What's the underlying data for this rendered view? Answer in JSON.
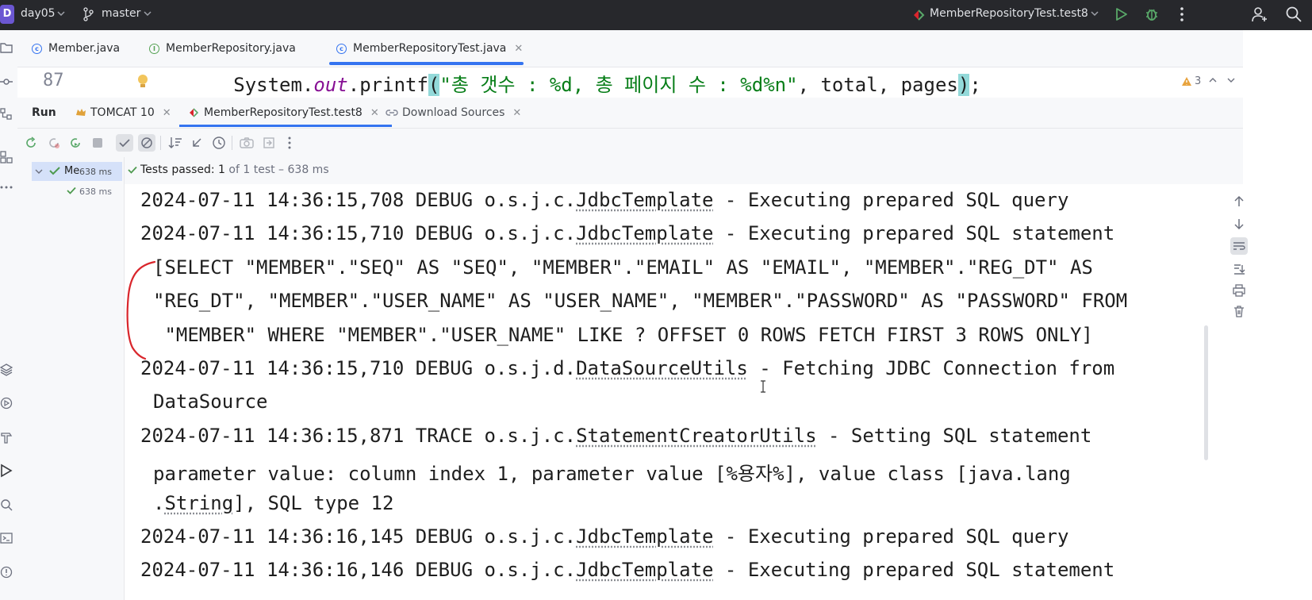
{
  "titlebar": {
    "project_badge": "D",
    "project_name": "day05",
    "branch": "master",
    "run_config": "MemberRepositoryTest.test8"
  },
  "editor_tabs": [
    {
      "label": "Member.java"
    },
    {
      "label": "MemberRepository.java"
    },
    {
      "label": "MemberRepositoryTest.java"
    }
  ],
  "code": {
    "line_number": "87",
    "indent": "     ",
    "obj": "System.",
    "field": "out",
    "method": ".printf",
    "open_paren": "(",
    "string": "\"총 갯수 : %d, 총 페이지 수 : %d%n\"",
    "args": ", total, pages",
    "close_paren": ")",
    "end": ";",
    "warnings": "3"
  },
  "run_panel": {
    "title": "Run",
    "tabs": [
      {
        "label": "TOMCAT 10"
      },
      {
        "label": "MemberRepositoryTest.test8"
      },
      {
        "label": "Download Sources"
      }
    ]
  },
  "tree": {
    "root_label": "Me",
    "root_time": "638 ms",
    "child_time": "638 ms"
  },
  "status": {
    "passed_prefix": "Tests passed: ",
    "passed_count": "1",
    "rest": " of 1 test – 638 ms"
  },
  "console": {
    "l1": {
      "prefix": "2024-07-11 14:36:15,708 DEBUG o.s.j.c.",
      "cls": "JdbcTemplate",
      "suffix": " - Executing prepared SQL query"
    },
    "l2": {
      "prefix": "2024-07-11 14:36:15,710 DEBUG o.s.j.c.",
      "cls": "JdbcTemplate",
      "suffix": " - Executing prepared SQL statement"
    },
    "l3": "[SELECT \"MEMBER\".\"SEQ\" AS \"SEQ\", \"MEMBER\".\"EMAIL\" AS \"EMAIL\", \"MEMBER\".\"REG_DT\" AS",
    "l4": "\"REG_DT\", \"MEMBER\".\"USER_NAME\" AS \"USER_NAME\", \"MEMBER\".\"PASSWORD\" AS \"PASSWORD\" FROM",
    "l5": " \"MEMBER\" WHERE \"MEMBER\".\"USER_NAME\" LIKE ? OFFSET 0 ROWS FETCH FIRST 3 ROWS ONLY]",
    "l6": {
      "prefix": "2024-07-11 14:36:15,710 DEBUG o.s.j.d.",
      "cls": "DataSourceUtils",
      "suffix": " - Fetching JDBC Connection from"
    },
    "l7": "DataSource",
    "l8": {
      "prefix": "2024-07-11 14:36:15,871 TRACE o.s.j.c.",
      "cls": "StatementCreatorUtils",
      "suffix": " - Setting SQL statement"
    },
    "l9": "parameter value: column index 1, parameter value [%용자%], value class [java.lang",
    "l10": {
      "prefix": ".",
      "cls": "String",
      "suffix": "], SQL type 12"
    },
    "l11": {
      "prefix": "2024-07-11 14:36:16,145 DEBUG o.s.j.c.",
      "cls": "JdbcTemplate",
      "suffix": " - Executing prepared SQL query"
    },
    "l12": {
      "prefix": "2024-07-11 14:36:16,146 DEBUG o.s.j.c.",
      "cls": "JdbcTemplate",
      "suffix": " - Executing prepared SQL statement"
    }
  },
  "colors": {
    "accent": "#3574f0",
    "passed_green": "#4e9a4f",
    "run_green": "#59a869",
    "annotation_red": "#d9262c",
    "string_green": "#067d17"
  },
  "icons": [
    "project-badge",
    "chevron-down-icon",
    "branch-icon",
    "run-config-icon",
    "run-icon",
    "debug-icon",
    "more-icon",
    "add-user-icon",
    "search-icon",
    "folder-icon",
    "commit-icon",
    "structure-icon",
    "plugins-icon",
    "more-tools-icon",
    "layers-icon",
    "services-icon",
    "build-icon",
    "run-tool-icon",
    "find-icon",
    "terminal-icon",
    "warning-icon",
    "bulb-icon",
    "rerun-icon",
    "stop-icon",
    "check-icon",
    "cancel-icon",
    "sort-icon",
    "import-icon",
    "history-icon",
    "camera-icon",
    "export-icon",
    "up-arrow-icon",
    "down-arrow-icon",
    "wrap-icon",
    "scroll-end-icon",
    "print-icon",
    "trash-icon",
    "close-icon",
    "minimize-icon"
  ]
}
